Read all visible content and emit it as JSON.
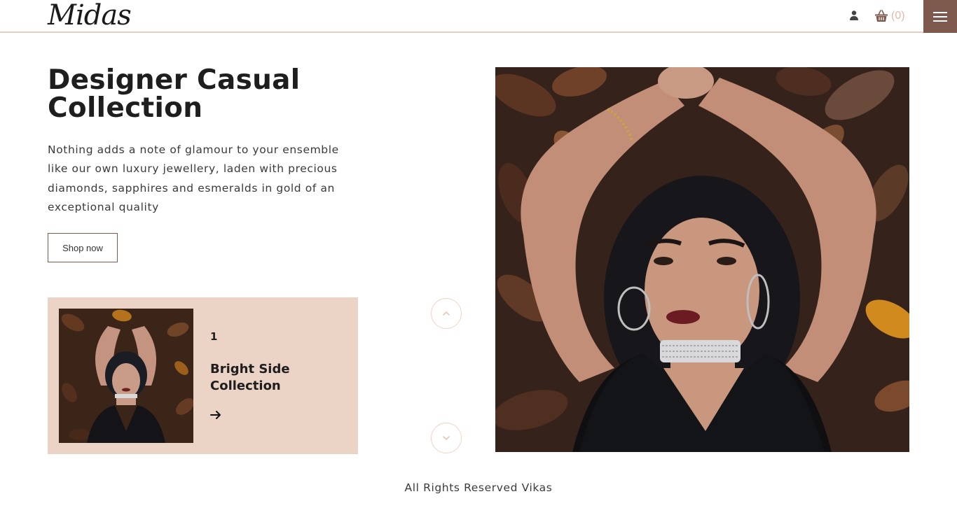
{
  "header": {
    "logo": "Midas",
    "cart_count": "(0)",
    "icons": {
      "user": "user-icon",
      "cart": "basket-icon",
      "menu": "hamburger-menu-icon"
    }
  },
  "hero": {
    "title": "Designer Casual Collection",
    "description": "Nothing adds a note of glamour to your ensemble like our own luxury jewellery, laden with precious diamonds, sapphires and esmeralds in gold of an exceptional quality",
    "button_label": "Shop now"
  },
  "slide": {
    "number": "1",
    "title": "Bright Side Collection"
  },
  "controls": {
    "up_icon": "chevron-up-icon",
    "down_icon": "chevron-down-icon"
  },
  "footer": {
    "text": "All Rights Reserved Vikas"
  },
  "colors": {
    "accent_brown": "#7d5a4d",
    "card_bg": "#ebd3c6",
    "border_pink": "#e7cfc3"
  }
}
